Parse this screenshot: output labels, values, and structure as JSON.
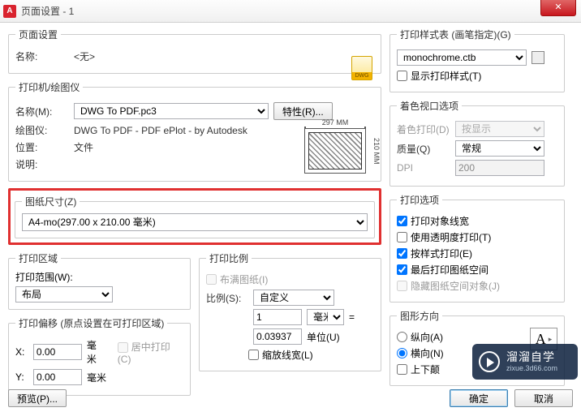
{
  "window": {
    "title": "页面设置 - 1",
    "close": "✕"
  },
  "pageSetup": {
    "legend": "页面设置",
    "nameLabel": "名称:",
    "nameValue": "<无>"
  },
  "printer": {
    "legend": "打印机/绘图仪",
    "nameLabel": "名称(M):",
    "nameValue": "DWG To PDF.pc3",
    "propsBtn": "特性(R)...",
    "plotterLabel": "绘图仪:",
    "plotterValue": "DWG To PDF - PDF ePlot - by Autodesk",
    "locLabel": "位置:",
    "locValue": "文件",
    "descLabel": "说明:",
    "dimW": "297 MM",
    "dimH": "210 MM"
  },
  "paper": {
    "legend": "图纸尺寸(Z)",
    "value": "A4-mo(297.00 x 210.00 毫米)"
  },
  "area": {
    "legend": "打印区域",
    "rangeLabel": "打印范围(W):",
    "rangeValue": "布局"
  },
  "scale": {
    "legend": "打印比例",
    "fitLabel": "布满图纸(I)",
    "scaleLabel": "比例(S):",
    "scaleValue": "自定义",
    "mmVal": "1",
    "mmUnit": "毫米",
    "unitVal": "0.03937",
    "unitLabel": "单位(U)",
    "scaleLwLabel": "缩放线宽(L)"
  },
  "offset": {
    "legend": "打印偏移 (原点设置在可打印区域)",
    "xLabel": "X:",
    "xVal": "0.00",
    "xUnit": "毫米",
    "yLabel": "Y:",
    "yVal": "0.00",
    "yUnit": "毫米",
    "centerLabel": "居中打印(C)"
  },
  "styleTable": {
    "legend": "打印样式表 (画笔指定)(G)",
    "value": "monochrome.ctb",
    "showLabel": "显示打印样式(T)"
  },
  "viewport": {
    "legend": "着色视口选项",
    "shadeLabel": "着色打印(D)",
    "shadeValue": "按显示",
    "qualityLabel": "质量(Q)",
    "qualityValue": "常规",
    "dpiLabel": "DPI",
    "dpiValue": "200"
  },
  "options": {
    "legend": "打印选项",
    "lw": "打印对象线宽",
    "trans": "使用透明度打印(T)",
    "styles": "按样式打印(E)",
    "last": "最后打印图纸空间",
    "hide": "隐藏图纸空间对象(J)"
  },
  "orient": {
    "legend": "图形方向",
    "portrait": "纵向(A)",
    "landscape": "横向(N)",
    "upside": "上下颠"
  },
  "footer": {
    "preview": "预览(P)...",
    "ok": "确定",
    "cancel": "取消"
  },
  "watermark": {
    "brand": "溜溜自学",
    "url": "zixue.3d66.com"
  }
}
